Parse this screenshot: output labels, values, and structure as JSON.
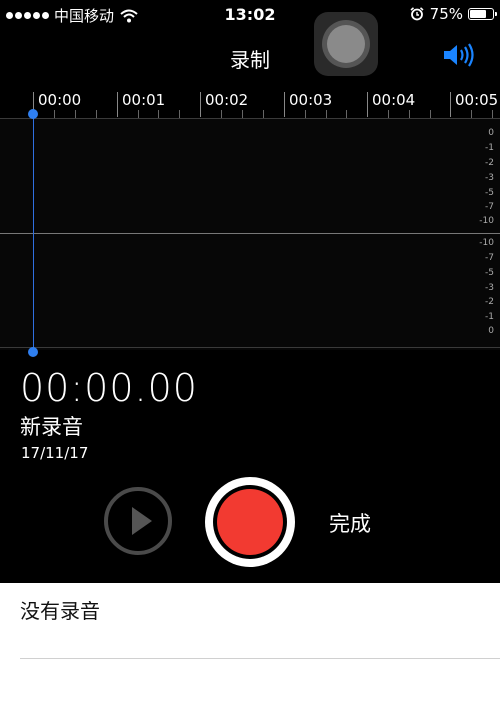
{
  "status_bar": {
    "carrier": "中国移动",
    "time": "13:02",
    "battery": "75%",
    "battery_level": 0.75,
    "icons": [
      "signal-dots-icon",
      "wifi-icon",
      "alarm-icon",
      "battery-icon"
    ]
  },
  "header": {
    "title": "录制",
    "speaker_icon": "speaker-icon",
    "accent": "#1a84ff"
  },
  "timeline": {
    "labels": [
      "00:00",
      "00:01",
      "00:02",
      "00:03",
      "00:04",
      "00:05"
    ]
  },
  "waveform": {
    "db_upper": [
      "0",
      "-1",
      "-2",
      "-3",
      "-5",
      "-7",
      "-10"
    ],
    "db_lower": [
      "-10",
      "-7",
      "-5",
      "-3",
      "-2",
      "-1",
      "0"
    ],
    "playhead_color": "#2f7ff0"
  },
  "recording": {
    "elapsed": "00:00.00",
    "name": "新录音",
    "date": "17/11/17"
  },
  "controls": {
    "play_icon": "play-icon",
    "record_color": "#f23a31",
    "done_label": "完成"
  },
  "list": {
    "empty_text": "没有录音"
  }
}
